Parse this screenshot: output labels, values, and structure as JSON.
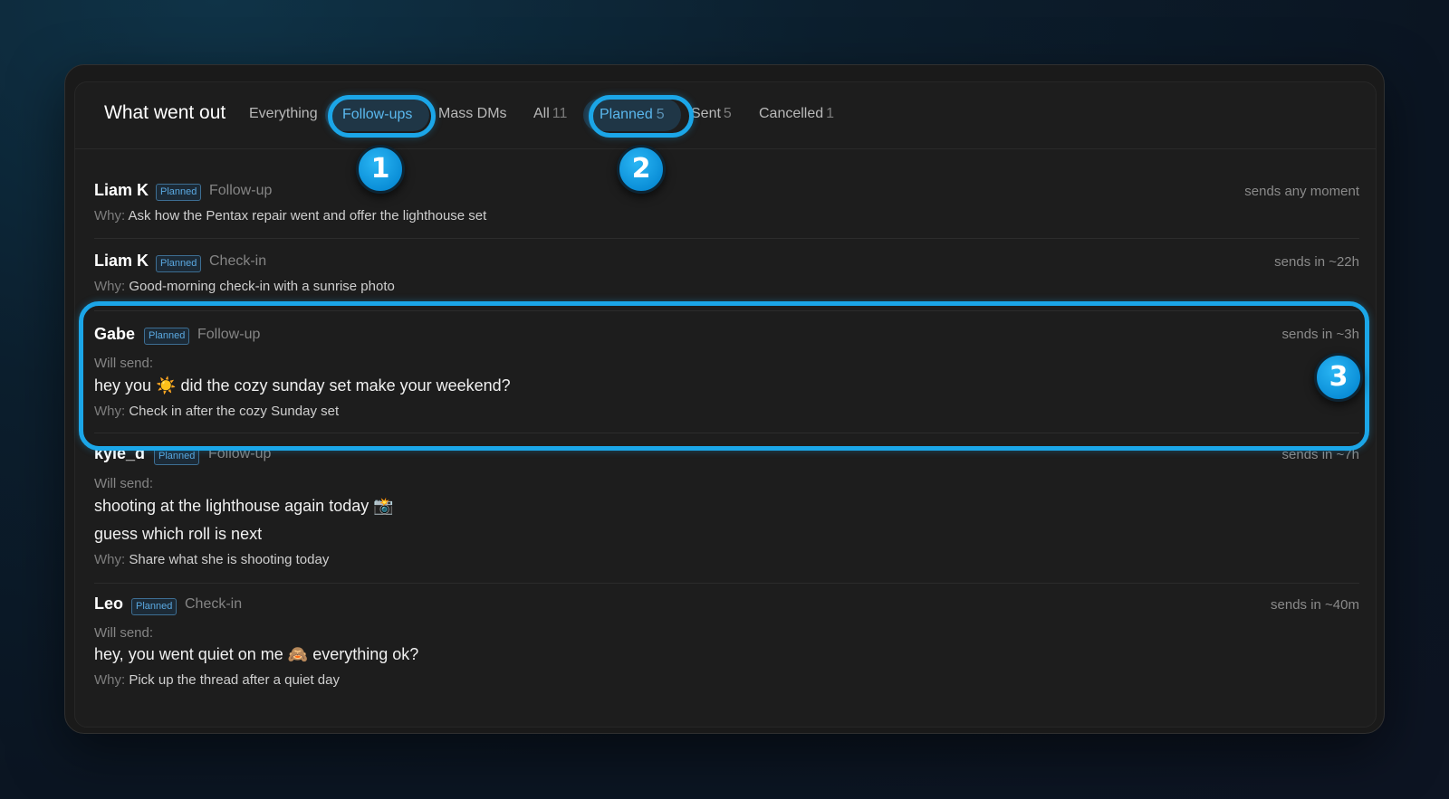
{
  "header": {
    "title": "What went out",
    "type_tabs": [
      {
        "label": "Everything"
      },
      {
        "label": "Follow-ups"
      },
      {
        "label": "Mass DMs"
      }
    ],
    "status_tabs": [
      {
        "label": "All",
        "count": "11"
      },
      {
        "label": "Planned",
        "count": "5"
      },
      {
        "label": "Sent",
        "count": "5"
      },
      {
        "label": "Cancelled",
        "count": "1"
      }
    ]
  },
  "rows": [
    {
      "name": "Liam K",
      "badge": "Planned",
      "kind": "Follow-up",
      "time": "sends any moment",
      "why_label": "Why:",
      "why": "Ask how the Pentax repair went and offer the lighthouse set"
    },
    {
      "name": "Liam K",
      "badge": "Planned",
      "kind": "Check-in",
      "time": "sends in ~22h",
      "why_label": "Why:",
      "why": "Good-morning check-in with a sunrise photo"
    },
    {
      "name": "Gabe",
      "badge": "Planned",
      "kind": "Follow-up",
      "time": "sends in ~3h",
      "will_send_label": "Will send:",
      "messages": [
        "hey you ☀️ did the cozy sunday set make your weekend?"
      ],
      "why_label": "Why:",
      "why": "Check in after the cozy Sunday set"
    },
    {
      "name": "kyle_d",
      "badge": "Planned",
      "kind": "Follow-up",
      "time": "sends in ~7h",
      "will_send_label": "Will send:",
      "messages": [
        "shooting at the lighthouse again today 📸",
        "guess which roll is next"
      ],
      "why_label": "Why:",
      "why": "Share what she is shooting today"
    },
    {
      "name": "Leo",
      "badge": "Planned",
      "kind": "Check-in",
      "time": "sends in ~40m",
      "will_send_label": "Will send:",
      "messages": [
        "hey, you went quiet on me 🙈 everything ok?"
      ],
      "why_label": "Why:",
      "why": "Pick up the thread after a quiet day"
    }
  ],
  "markers": [
    "1",
    "2",
    "3"
  ],
  "colors": {
    "accent": "#1ba6e8",
    "badge": "#5aa8e0",
    "background": "#1d1d1d"
  }
}
